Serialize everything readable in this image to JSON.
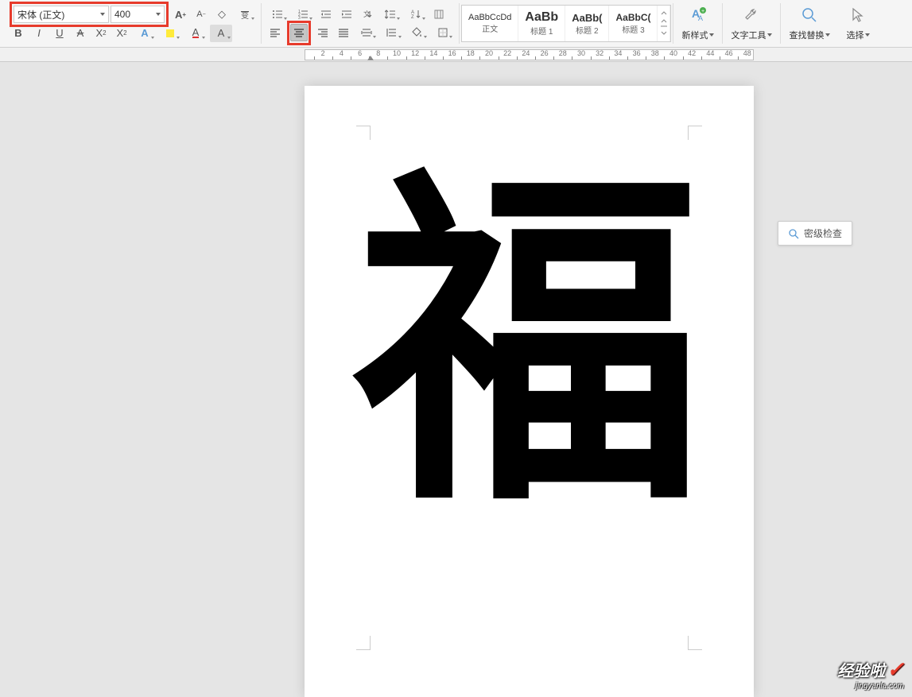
{
  "font": {
    "name": "宋体 (正文)",
    "size": "400"
  },
  "formatting": {
    "bold": "B",
    "italic": "I",
    "underline": "U",
    "strikethrough": "S",
    "increase_font": "A",
    "decrease_font": "A",
    "clear_format": "Ѻ",
    "font_color": "A",
    "highlight": "A",
    "xsub": "X",
    "xsup": "X"
  },
  "paragraph": {
    "align_left": "≡",
    "align_center": "≡",
    "align_right": "≡",
    "justify": "≡"
  },
  "styles": {
    "items": [
      {
        "preview": "AaBbCcDd",
        "name": "正文"
      },
      {
        "preview": "AaBb",
        "name": "标题 1"
      },
      {
        "preview": "AaBb(",
        "name": "标题 2"
      },
      {
        "preview": "AaBbC(",
        "name": "标题 3"
      }
    ]
  },
  "buttons": {
    "new_style": "新样式",
    "text_tools": "文字工具",
    "find_replace": "查找替换",
    "select": "选择"
  },
  "ruler": {
    "labels": [
      "2",
      "4",
      "6",
      "8",
      "10",
      "12",
      "14",
      "16",
      "18",
      "20",
      "22",
      "24",
      "26",
      "28",
      "30",
      "32",
      "34",
      "36",
      "38",
      "40",
      "42",
      "44",
      "46",
      "48"
    ]
  },
  "doc": {
    "character": "福"
  },
  "floating": {
    "security_check": "密级检查"
  },
  "watermark": {
    "main": "经验啦",
    "sub": "jingyanla.com"
  }
}
